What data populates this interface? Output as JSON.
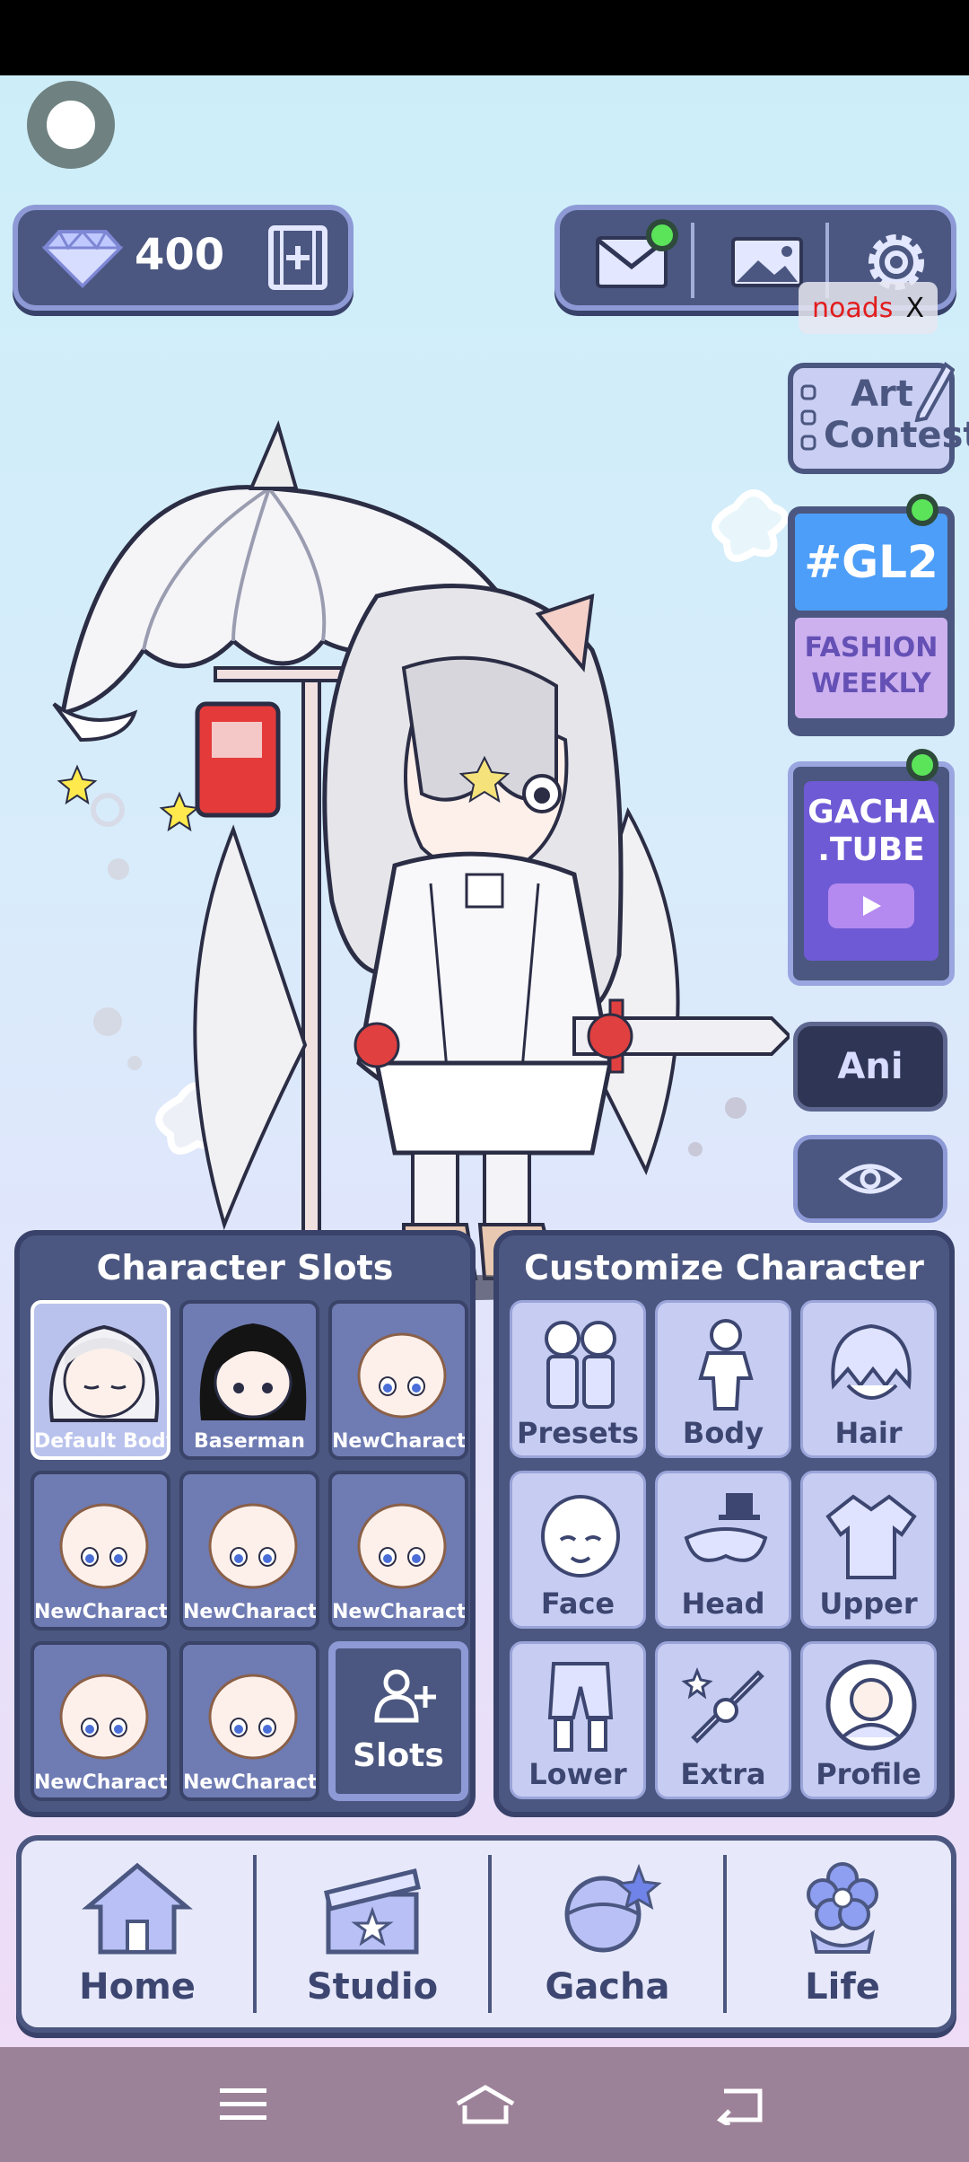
{
  "currency": {
    "gems": "400"
  },
  "notifications": {
    "noads_label": "noads",
    "noads_close": "X"
  },
  "side_buttons": {
    "art_contest": "Art\nContest",
    "gl2_top": "#GL2",
    "gl2_bottom": "FASHION\nWEEKLY",
    "gacha_tube": "GACHA\n.TUBE",
    "ani": "Ani"
  },
  "character_slots": {
    "title": "Character Slots",
    "slots": [
      {
        "label": "Default Body"
      },
      {
        "label": "Baserman"
      },
      {
        "label": "NewCharacter"
      },
      {
        "label": "NewCharacter"
      },
      {
        "label": "NewCharacter"
      },
      {
        "label": "NewCharacter"
      },
      {
        "label": "NewCharacter"
      },
      {
        "label": "NewCharacter"
      }
    ],
    "add_slots_label": "Slots"
  },
  "customize": {
    "title": "Customize Character",
    "tiles": [
      {
        "label": "Presets"
      },
      {
        "label": "Body"
      },
      {
        "label": "Hair"
      },
      {
        "label": "Face"
      },
      {
        "label": "Head"
      },
      {
        "label": "Upper"
      },
      {
        "label": "Lower"
      },
      {
        "label": "Extra"
      },
      {
        "label": "Profile"
      }
    ]
  },
  "bottom_nav": [
    {
      "label": "Home"
    },
    {
      "label": "Studio"
    },
    {
      "label": "Gacha"
    },
    {
      "label": "Life"
    }
  ],
  "colors": {
    "panel": "#4b5780",
    "accent_border": "#8e9ad6",
    "notification_dot": "#5be35a"
  }
}
